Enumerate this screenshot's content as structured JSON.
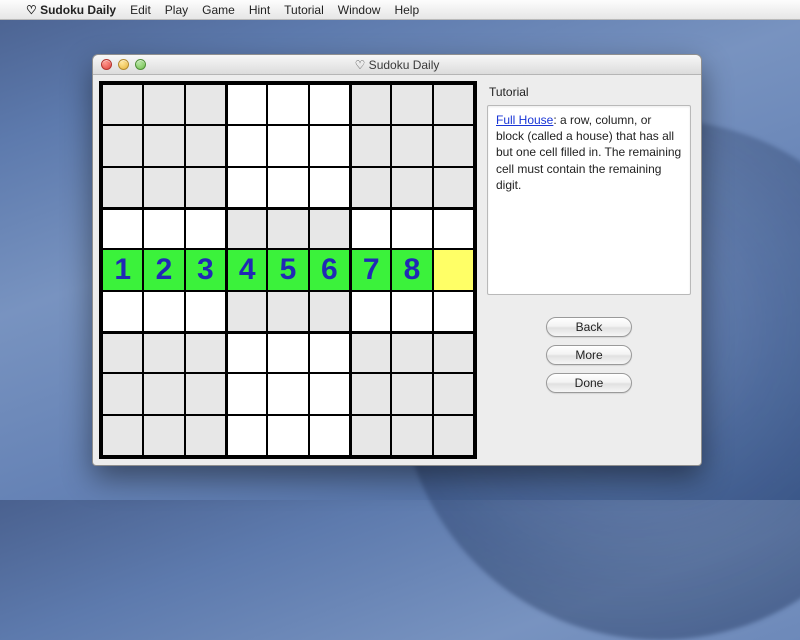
{
  "menubar": {
    "app_name": "♡ Sudoku Daily",
    "items": [
      "Edit",
      "Play",
      "Game",
      "Hint",
      "Tutorial",
      "Window",
      "Help"
    ]
  },
  "window": {
    "title": "♡ Sudoku Daily"
  },
  "tutorial": {
    "heading": "Tutorial",
    "link_text": "Full House",
    "body_after": ": a row, column, or block (called a house) that has all but one cell filled in. The remaining cell must contain the remaining digit.",
    "buttons": {
      "back": "Back",
      "more": "More",
      "done": "Done"
    }
  },
  "grid": {
    "highlight_row": 4,
    "values_row": [
      "1",
      "2",
      "3",
      "4",
      "5",
      "6",
      "7",
      "8",
      ""
    ],
    "empty_cell_col": 8
  }
}
